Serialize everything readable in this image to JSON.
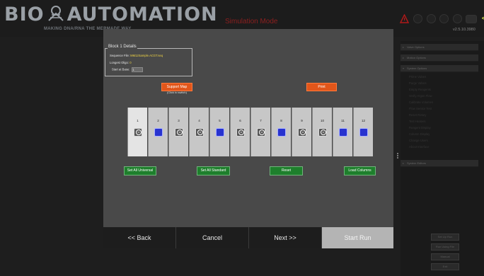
{
  "header": {
    "brand_left": "BIO",
    "brand_right": "AUTOMATION",
    "tagline": "MAKING DNA/RNA THE MERMADE WAY",
    "mode": "Simulation Mode",
    "version": "v2.5.10.3980"
  },
  "block_details": {
    "legend": "Block 1 Details",
    "sequence_file_label": "Sequence File:",
    "sequence_file_value": "MM12Sample.ACGT.seq",
    "longest_oligo_label": "Longest Oligo:",
    "longest_oligo_value": "0",
    "start_at_base_label": "Start at Base:",
    "start_at_base_value": "1"
  },
  "support_map": {
    "button_label": "Support Map",
    "hint": "(Click to switch)"
  },
  "print_label": "Print",
  "columns": [
    {
      "label": "1",
      "support": "universal",
      "selected": true
    },
    {
      "label": "2",
      "support": "standard",
      "selected": false
    },
    {
      "label": "3",
      "support": "universal",
      "selected": false
    },
    {
      "label": "4",
      "support": "universal",
      "selected": false
    },
    {
      "label": "5",
      "support": "standard",
      "selected": false
    },
    {
      "label": "6",
      "support": "universal",
      "selected": false
    },
    {
      "label": "7",
      "support": "universal",
      "selected": false
    },
    {
      "label": "8",
      "support": "standard",
      "selected": false
    },
    {
      "label": "9",
      "support": "universal",
      "selected": false
    },
    {
      "label": "10",
      "support": "universal",
      "selected": false
    },
    {
      "label": "11",
      "support": "standard",
      "selected": false
    },
    {
      "label": "12",
      "support": "standard",
      "selected": false
    }
  ],
  "actions": {
    "set_all_universal": "Set All Universal",
    "set_all_standard": "Set All Standard",
    "reset": "Reset",
    "load_columns": "Load Columns"
  },
  "nav": {
    "back": "<< Back",
    "cancel": "Cancel",
    "next": "Next >>",
    "start": "Start Run"
  },
  "side_panel": {
    "sections": [
      "Valve Options",
      "Motion Options",
      "System Options",
      "System Editors"
    ],
    "system_items": [
      "Prime Valves",
      "Purge Valves",
      "Empty Reagents",
      "Verify Argon Flow",
      "Calibrate Volumes",
      "Flow Sensor Test",
      "Reset Rotary",
      "Test Heaters",
      "Reagent Display",
      "Column Display",
      "Change Users",
      "About Interface"
    ],
    "buttons": [
      "Set Up Run",
      "Run Using File",
      "Manual",
      "Exit"
    ]
  },
  "colors": {
    "accent_orange": "#e2561a",
    "accent_green": "#1e7f2c",
    "standard_blue": "#2833cf",
    "mode_red": "#8e1f1f"
  },
  "icons": [
    "dna-logo-icon",
    "warning-icon",
    "status-dot-icon",
    "camera-icon",
    "arrow-icon",
    "universal-support-icon",
    "standard-support-icon",
    "chevron-icon"
  ]
}
